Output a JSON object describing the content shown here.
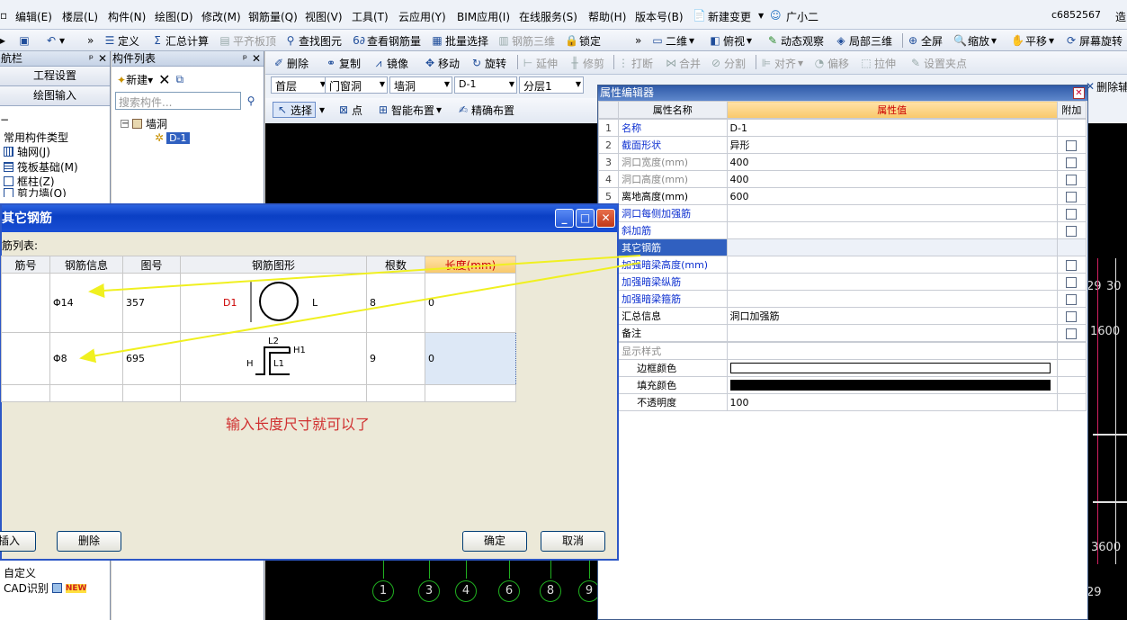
{
  "menu": [
    "编辑(E)",
    "楼层(L)",
    "构件(N)",
    "绘图(D)",
    "修改(M)",
    "钢筋量(Q)",
    "视图(V)",
    "工具(T)",
    "云应用(Y)",
    "BIM应用(I)",
    "在线服务(S)",
    "帮助(H)",
    "版本号(B)"
  ],
  "menu_right": {
    "new_change": "新建变更",
    "assistant": "广小二",
    "account": "c6852567",
    "tail": "造"
  },
  "toolbar": {
    "define": "定义",
    "sum_calc": "汇总计算",
    "flat_slab": "平齐板顶",
    "find": "查找图元",
    "view_rebar": "查看钢筋量",
    "batch_select": "批量选择",
    "rebar_3d": "钢筋三维",
    "lock": "锁定",
    "view2d": "二维",
    "top_view": "俯视",
    "dynamic": "动态观察",
    "local3d": "局部三维",
    "fullscreen": "全屏",
    "zoom": "缩放",
    "pan": "平移",
    "rotate_screen": "屏幕旋转"
  },
  "edit_toolbar": {
    "delete": "删除",
    "copy": "复制",
    "mirror": "镜像",
    "move": "移动",
    "rotate": "旋转",
    "extend": "延伸",
    "trim": "修剪",
    "break": "打断",
    "merge": "合并",
    "split": "分割",
    "align": "对齐",
    "offset": "偏移",
    "stretch": "拉伸",
    "set_pin": "设置夹点",
    "delete_aux": "删除辅"
  },
  "selectors": {
    "floor": "首层",
    "category": "门窗洞",
    "type": "墙洞",
    "item": "D-1",
    "layer": "分层1"
  },
  "draw_toolbar": {
    "select": "选择",
    "point": "点",
    "smart": "智能布置",
    "precise": "精确布置"
  },
  "nav": {
    "title": "航栏",
    "project_settings": "工程设置",
    "draw_input": "绘图输入",
    "tree_items": [
      "常用构件类型",
      "轴网(J)",
      "筏板基础(M)",
      "框柱(Z)",
      "剪力墙(Q)"
    ],
    "bottom_items": [
      "自定义",
      "CAD识别"
    ],
    "new_badge": "NEW"
  },
  "component_list": {
    "title": "构件列表",
    "new": "新建",
    "search_placeholder": "搜索构件...",
    "tree_parent": "墙洞",
    "tree_child": "D-1"
  },
  "property_editor": {
    "title": "属性编辑器",
    "headers": {
      "name": "属性名称",
      "value": "属性值",
      "attach": "附加"
    },
    "rows": [
      {
        "n": "1",
        "name": "名称",
        "value": "D-1",
        "style": "blue",
        "cb": false
      },
      {
        "n": "2",
        "name": "截面形状",
        "value": "异形",
        "style": "blue",
        "cb": true
      },
      {
        "n": "3",
        "name": "洞口宽度(mm)",
        "value": "400",
        "style": "gray",
        "cb": true
      },
      {
        "n": "4",
        "name": "洞口高度(mm)",
        "value": "400",
        "style": "gray",
        "cb": true
      },
      {
        "n": "5",
        "name": "离地高度(mm)",
        "value": "600",
        "style": "black",
        "cb": true
      },
      {
        "n": "",
        "name": "洞口每侧加强筋",
        "value": "",
        "style": "blue",
        "cb": true
      },
      {
        "n": "",
        "name": "斜加筋",
        "value": "",
        "style": "blue",
        "cb": true
      },
      {
        "n": "",
        "name": "其它钢筋",
        "value": "",
        "style": "sel",
        "cb": false
      },
      {
        "n": "",
        "name": "加强暗梁高度(mm)",
        "value": "",
        "style": "blue",
        "cb": true
      },
      {
        "n": "",
        "name": "加强暗梁纵筋",
        "value": "",
        "style": "blue",
        "cb": true
      },
      {
        "n": "",
        "name": "加强暗梁箍筋",
        "value": "",
        "style": "blue",
        "cb": true
      },
      {
        "n": "",
        "name": "汇总信息",
        "value": "洞口加强筋",
        "style": "black",
        "cb": true
      },
      {
        "n": "",
        "name": "备注",
        "value": "",
        "style": "black",
        "cb": true
      }
    ],
    "display_group": "显示样式",
    "display_rows": [
      {
        "name": "边框颜色",
        "color": "#ffffff"
      },
      {
        "name": "填充颜色",
        "color": "#000000"
      },
      {
        "name": "不透明度",
        "text": "100"
      }
    ]
  },
  "dialog": {
    "title": "其它钢筋",
    "list_label": "筋列表:",
    "headers": [
      "筋号",
      "钢筋信息",
      "图号",
      "钢筋图形",
      "根数",
      "长度(mm)"
    ],
    "rows": [
      {
        "info": "Φ14",
        "fig": "357",
        "count": "8",
        "length": "0",
        "shape": "ring",
        "labels": {
          "d": "D1",
          "l": "L"
        }
      },
      {
        "info": "Φ8",
        "fig": "695",
        "count": "9",
        "length": "0",
        "shape": "hook",
        "labels": {
          "l2": "L2",
          "h1": "H1",
          "h": "H",
          "l1": "L1"
        }
      }
    ],
    "note": "输入长度尺寸就可以了",
    "btn_insert": "插入",
    "btn_delete": "删除",
    "btn_ok": "确定",
    "btn_cancel": "取消"
  },
  "cad": {
    "axis_numbers": [
      "1",
      "3",
      "4",
      "6",
      "8",
      "9"
    ],
    "right_labels": [
      "29",
      "30",
      "1600",
      "3600",
      "29"
    ]
  }
}
